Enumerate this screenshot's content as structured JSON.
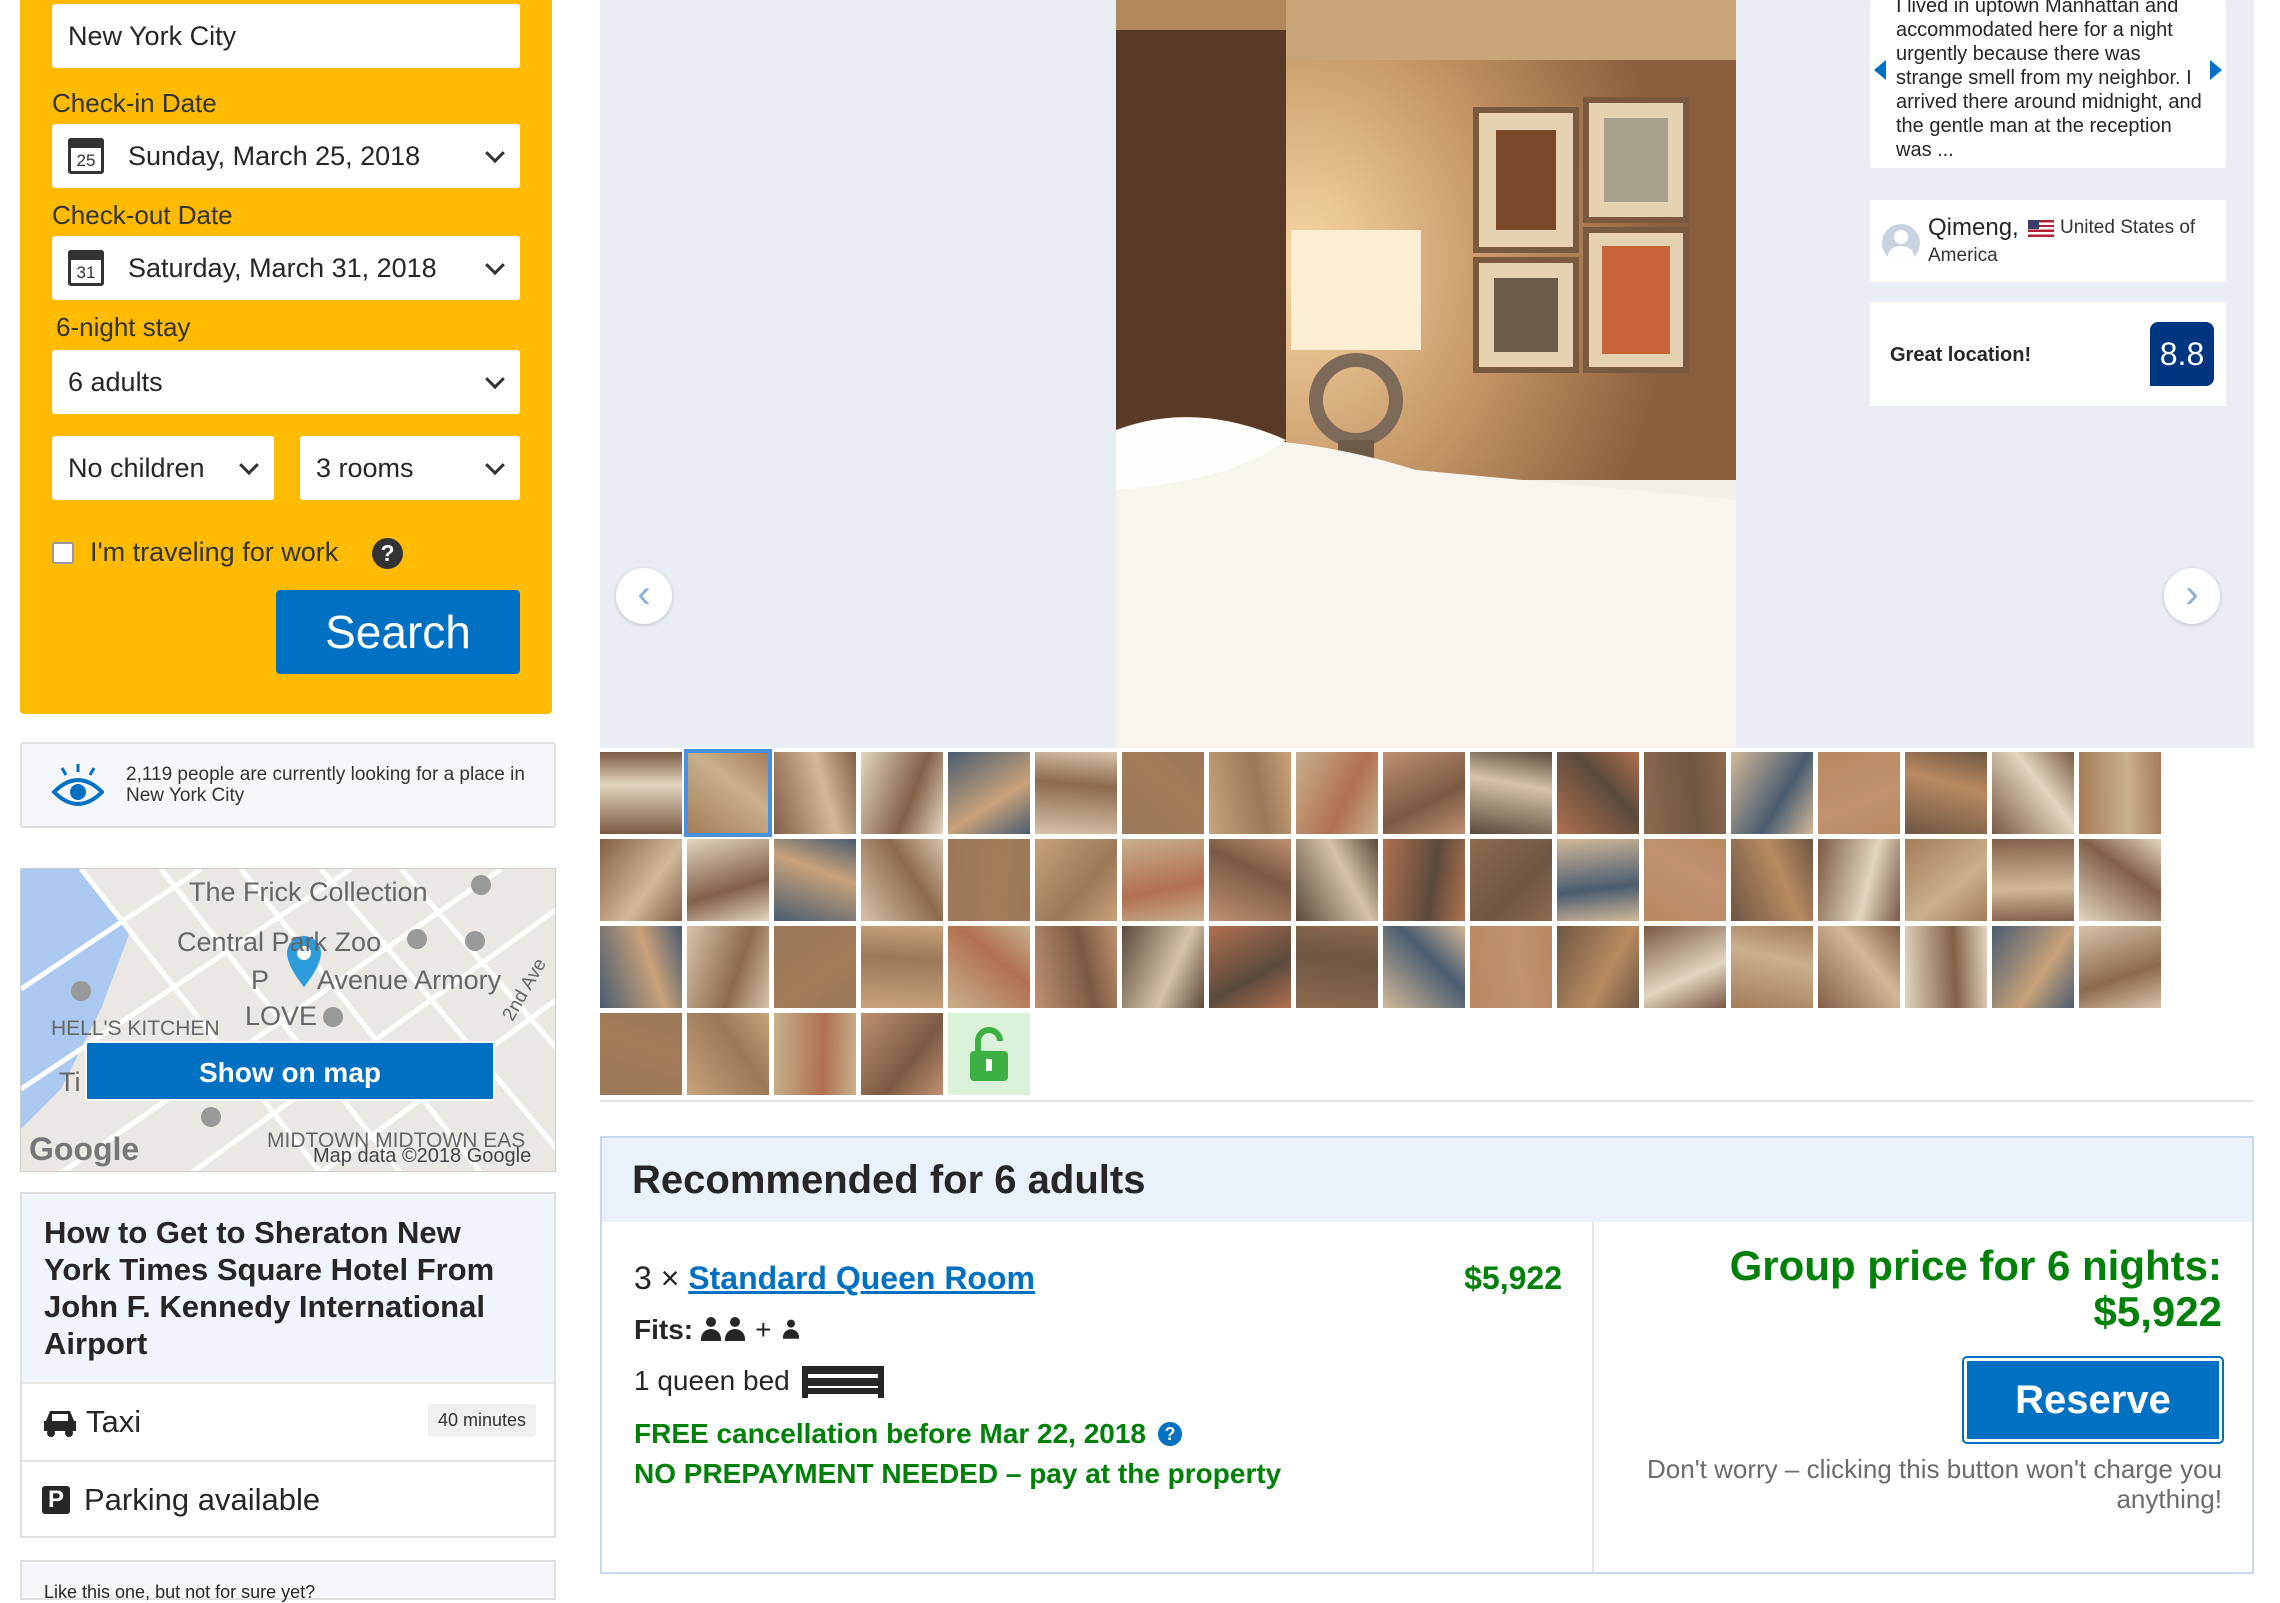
{
  "search": {
    "destination": "New York City",
    "checkin_label": "Check-in Date",
    "checkin_day": "25",
    "checkin_value": "Sunday, March 25, 2018",
    "checkout_label": "Check-out Date",
    "checkout_day": "31",
    "checkout_value": "Saturday, March 31, 2018",
    "stay_length": "6-night stay",
    "adults": "6 adults",
    "children": "No children",
    "rooms": "3 rooms",
    "work_label": "I'm traveling for work",
    "help": "?",
    "search_button": "Search",
    "accent": "#febb02"
  },
  "looking": {
    "text": "2,119 people are currently looking for a place in New York City"
  },
  "map": {
    "labels": [
      "The Frick Collection",
      "Central Park Zoo",
      "P",
      "Avenue Armory",
      "HELL'S KITCHEN",
      "LOVE",
      "2nd Ave",
      "MIDTOWN MIDTOWN EAS",
      "Ti"
    ],
    "google_logo": "Google",
    "attribution": "Map data ©2018 Google",
    "button": "Show on map"
  },
  "directions": {
    "title": "How to Get to Sheraton New York Times Square Hotel From John F. Kennedy International Airport",
    "taxi_label": "Taxi",
    "taxi_time": "40 minutes",
    "parking_icon": "P",
    "parking_label": "Parking available",
    "like_text": "Like this one, but not for sure yet?"
  },
  "review": {
    "text": "I lived in uptown Manhattan and accommodated here for a night urgently because there was strange smell from my neighbor. I arrived there around midnight, and the gentle man at the reception was ...",
    "reviewer": "Qimeng,",
    "country": "United States of America",
    "score_label": "Great location!",
    "score": "8.8"
  },
  "gallery": {
    "prev": "‹",
    "next": "›",
    "selected_thumb": 1,
    "thumb_count": 58
  },
  "recommended": {
    "title": "Recommended for 6 adults",
    "room_qty": "3 ×",
    "room_name": "Standard Queen Room",
    "room_price": "$5,922",
    "fits_label": "Fits:",
    "plus": "+",
    "bed": "1 queen bed",
    "free_cancel": "FREE cancellation before Mar 22, 2018",
    "no_prepay": "NO PREPAYMENT NEEDED – pay at the property",
    "group_label": "Group price for 6 nights:",
    "group_price": "$5,922",
    "reserve": "Reserve",
    "worry": "Don't worry – clicking this button won't charge you anything!"
  }
}
